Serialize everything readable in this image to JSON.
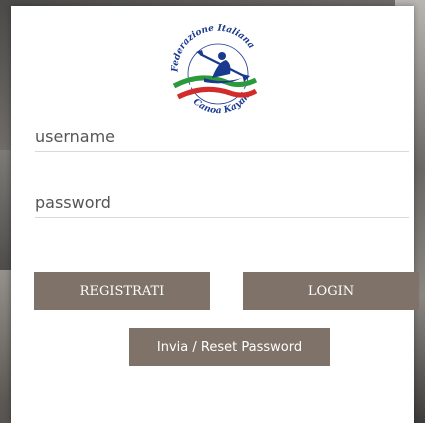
{
  "logo": {
    "text_top": "Federazione Italiana",
    "text_bottom": "Canoa Kayak",
    "colors": {
      "blue": "#1a3a8f",
      "green": "#2c9a3a",
      "red": "#d12b2b"
    }
  },
  "form": {
    "username_placeholder": "username",
    "password_placeholder": "password"
  },
  "buttons": {
    "register_label": "REGISTRATI",
    "login_label": "LOGIN",
    "reset_label": "Invia / Reset Password"
  },
  "colors": {
    "button_bg": "#7f7269",
    "card_bg": "#ffffff"
  }
}
